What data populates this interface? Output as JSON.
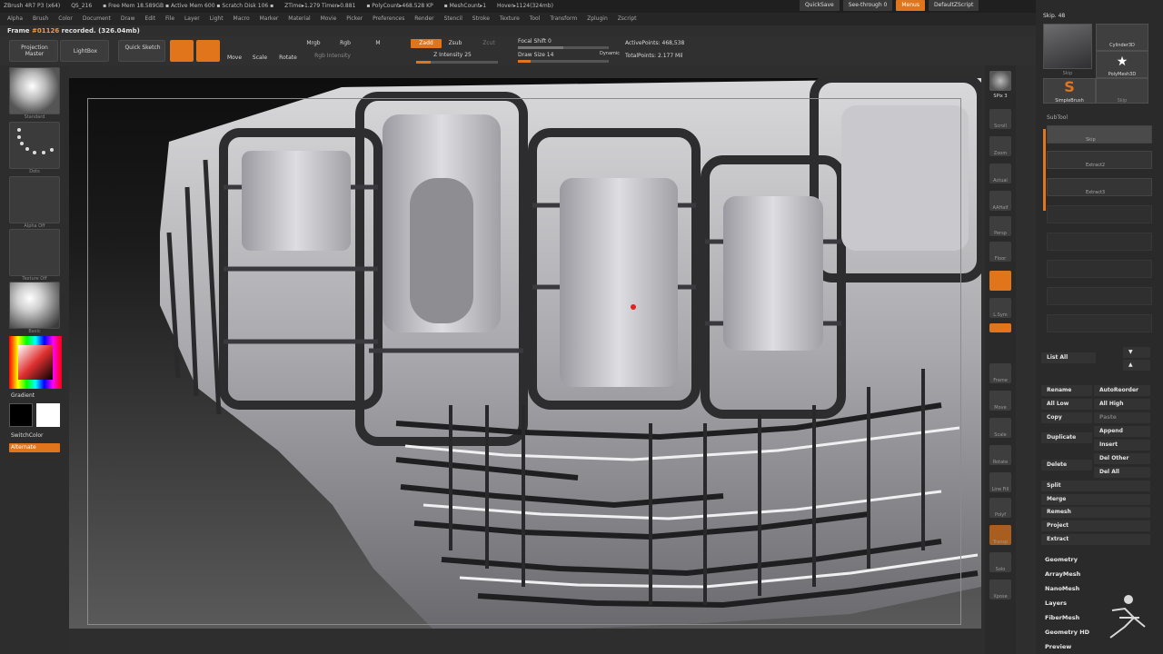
{
  "title_bar": {
    "items": [
      "ZBrush 4R7 P3 (x64)",
      "QS_216",
      "▪ Free Mem 18.589GB ▪ Active Mem 600 ▪ Scratch Disk 106 ▪",
      "ZTime▸1.279 Timer▸0.881",
      "▪ PolyCount▸468.528 KP",
      "▪ MeshCount▸1",
      "Hover▸1124(324mb)"
    ]
  },
  "menu": [
    "Alpha",
    "Brush",
    "Color",
    "Document",
    "Draw",
    "Edit",
    "File",
    "Layer",
    "Light",
    "Macro",
    "Marker",
    "Material",
    "Movie",
    "Picker",
    "Preferences",
    "Render",
    "Stencil",
    "Stroke",
    "Texture",
    "Tool",
    "Transform",
    "Zplugin",
    "Zscript"
  ],
  "top_right": {
    "quicksave": "QuickSave",
    "seethrough": "See-through  0",
    "menus": "Menus",
    "script": "DefaultZScript"
  },
  "frame_status": {
    "prefix": "Frame",
    "number": "#01126",
    "suffix": "recorded. (326.04mb)"
  },
  "toolbar": {
    "projection_master": "Projection Master",
    "lightbox": "LightBox",
    "quick_sketch": "Quick Sketch",
    "edit": "Edit",
    "draw": "Draw",
    "move": "Move",
    "scale": "Scale",
    "rotate": "Rotate",
    "mrgb": "Mrgb",
    "rgb": "Rgb",
    "m": "M",
    "rgb_intensity": "Rgb Intensity",
    "zadd": "Zadd",
    "zsub": "Zsub",
    "zcut": "Zcut",
    "z_intensity": "Z Intensity 25",
    "focal_shift": "Focal Shift 0",
    "draw_size": "Draw Size 14",
    "dynamic": "Dynamic",
    "active_points": "ActivePoints: 468,538",
    "total_points": "TotalPoints: 2.177 Mil"
  },
  "left_shelf": {
    "captions": [
      "Standard",
      "Dots",
      "Alpha Off",
      "Texture Off",
      "Basic"
    ],
    "gradient": "Gradient",
    "switch_color": "SwitchColor",
    "alternate": "Alternate",
    "colors": {
      "primary": "#000000",
      "secondary": "#ffffff"
    }
  },
  "right_shelf": {
    "captions": [
      "SPix 3",
      "Scroll",
      "Zoom",
      "Actual",
      "AAHalf",
      "Persp",
      "Floor",
      "L.Sym",
      "Frame",
      "Move",
      "Scale",
      "Rotate",
      "Line Fill",
      "Polyf",
      "Transp",
      "Solo",
      "Xpose"
    ]
  },
  "tray": {
    "skip_label": "Skip. 48",
    "tools": [
      "Skip",
      "Cylinder3D",
      "PolyMesh3D",
      "SimpleBrush",
      "Skip"
    ],
    "subtool_header": "SubTool",
    "subtools": [
      "Skip",
      "Extract2",
      "Extract3"
    ],
    "list_all": "List All",
    "buttons": {
      "rename": "Rename",
      "autoreorder": "AutoReorder",
      "all_low": "All Low",
      "all_high": "All High",
      "copy": "Copy",
      "paste": "Paste",
      "duplicate": "Duplicate",
      "append": "Append",
      "insert": "Insert",
      "delete": "Delete",
      "del_other": "Del Other",
      "del_all": "Del All",
      "split": "Split",
      "merge": "Merge",
      "remesh": "Remesh",
      "project": "Project",
      "extract": "Extract"
    },
    "menus": [
      "Geometry",
      "ArrayMesh",
      "NanoMesh",
      "Layers",
      "FiberMesh",
      "Geometry HD",
      "Preview"
    ]
  },
  "accent_color": "#e0751c"
}
